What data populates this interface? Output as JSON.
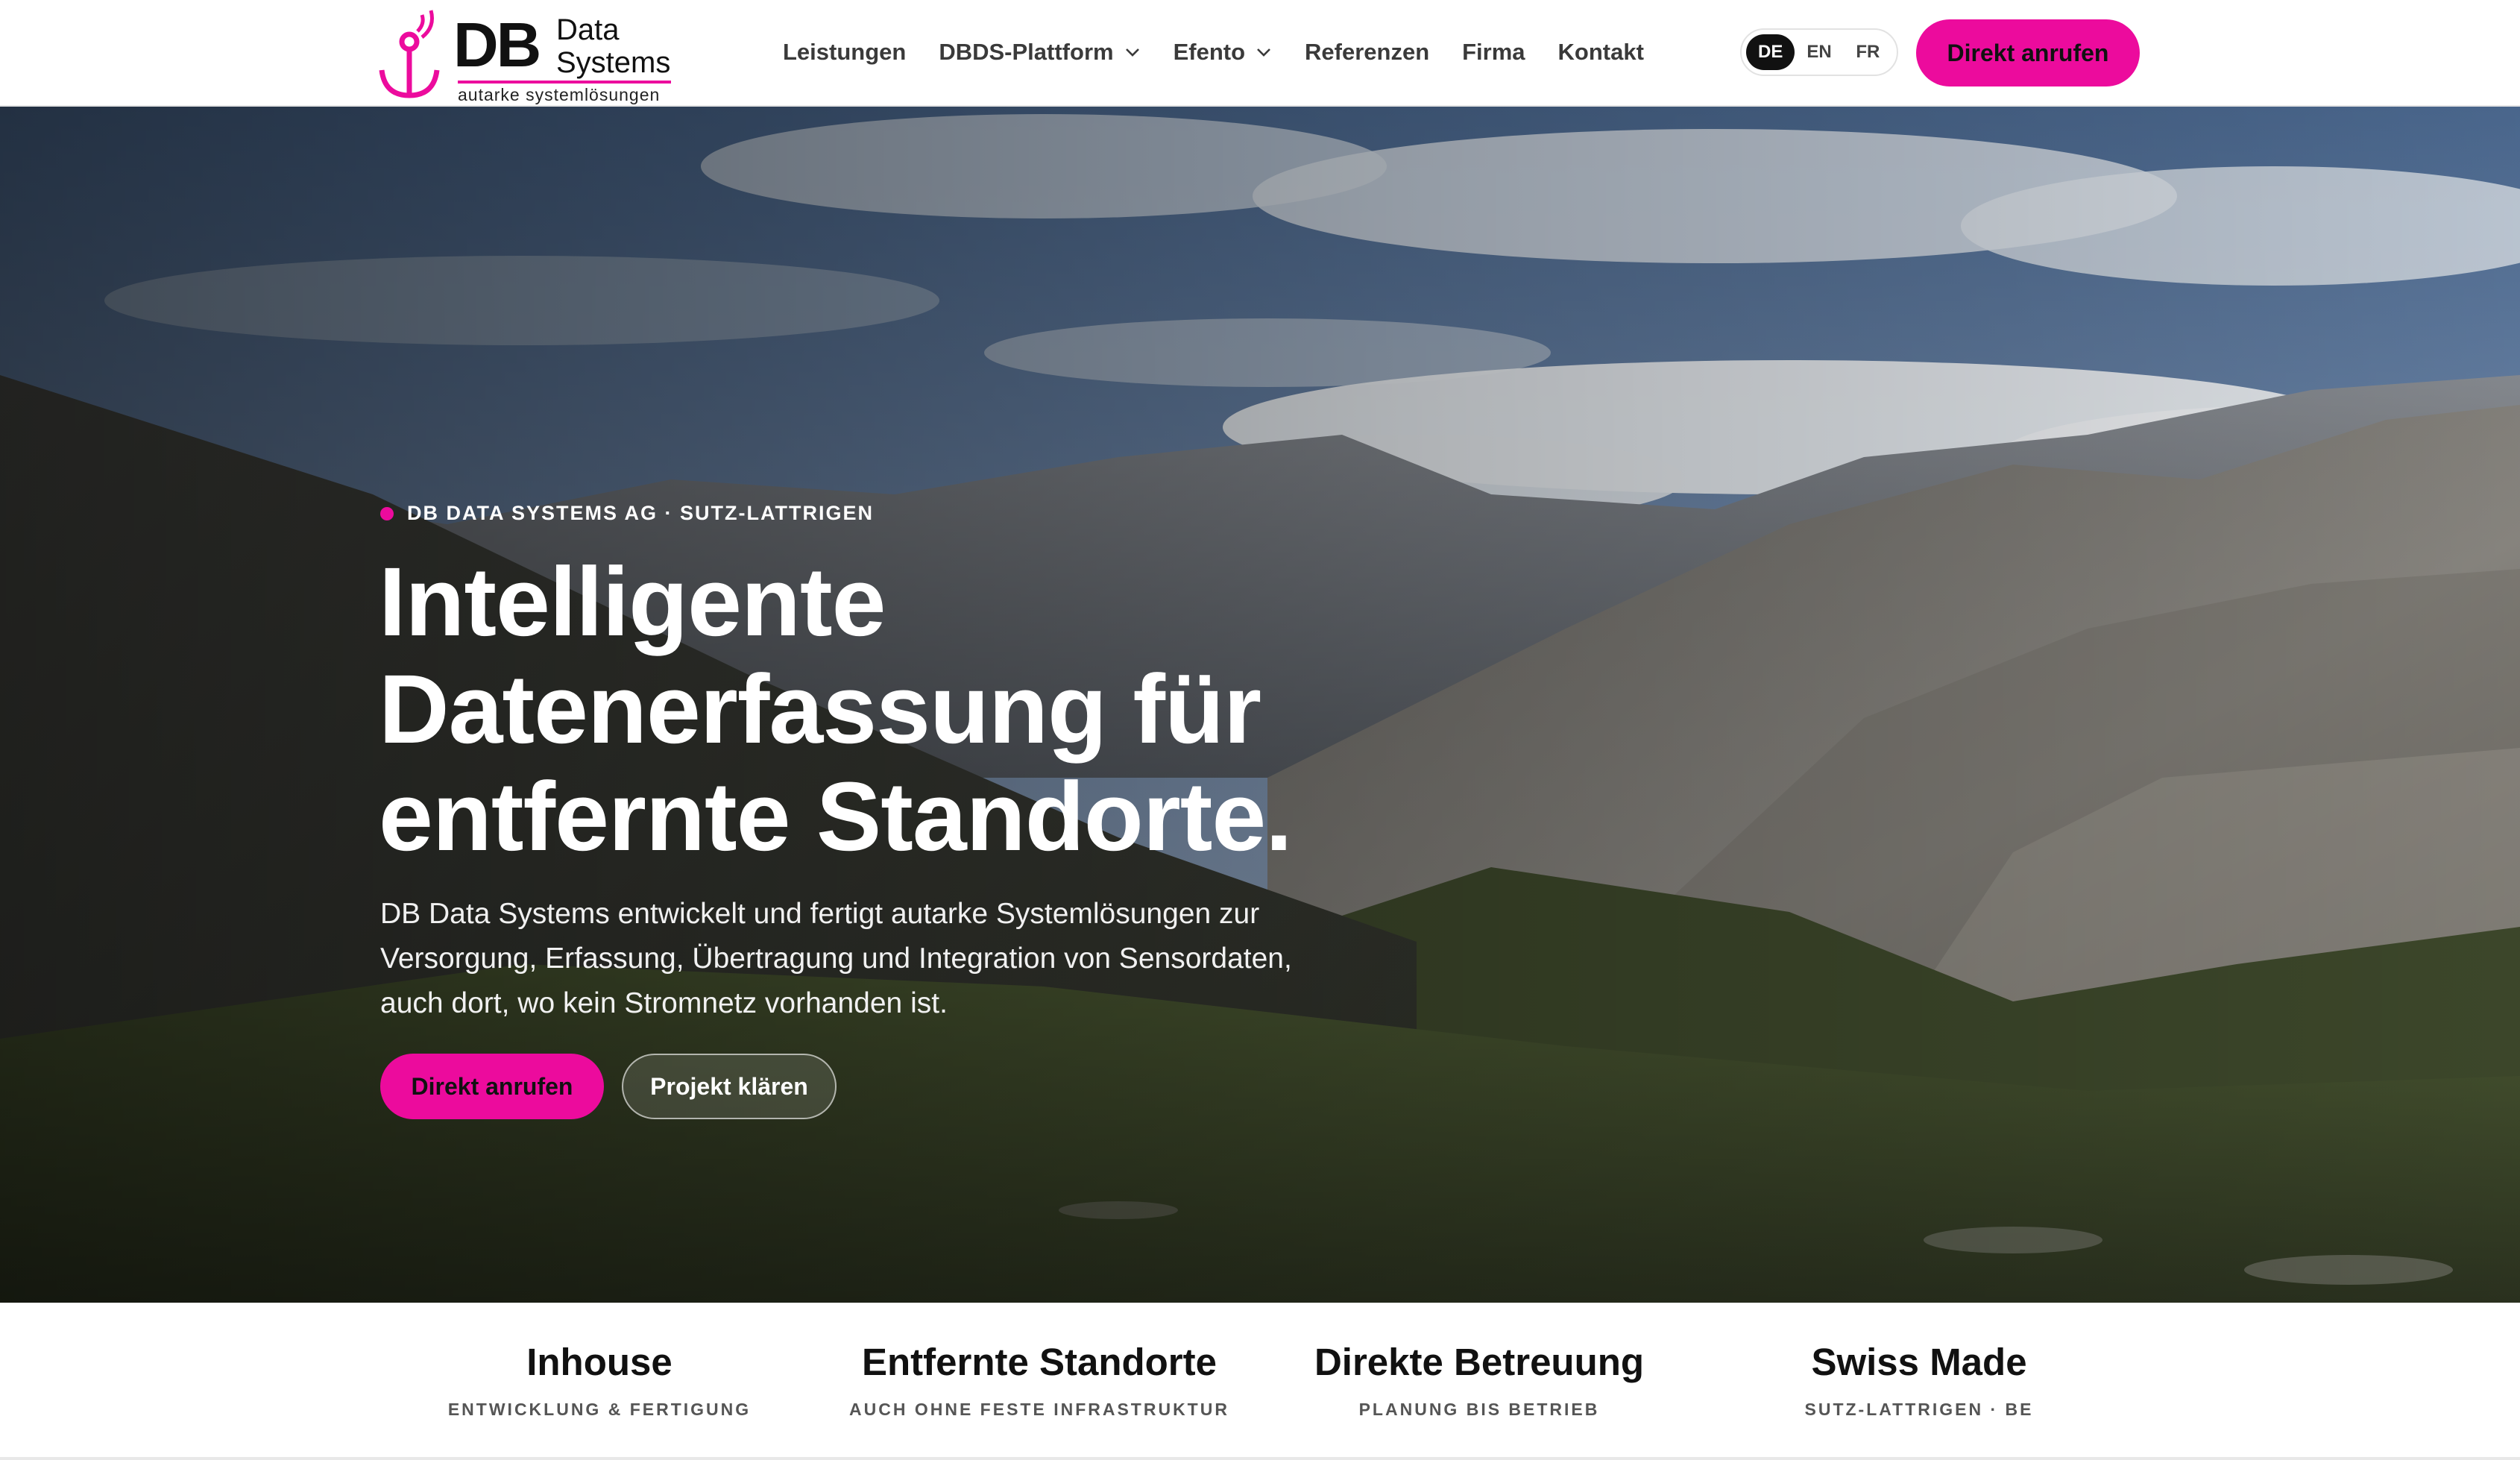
{
  "header": {
    "logo": {
      "db": "DB",
      "data": "Data",
      "systems": "Systems",
      "tagline": "autarke systemlösungen"
    },
    "nav": [
      {
        "label": "Leistungen",
        "has_dropdown": false
      },
      {
        "label": "DBDS-Plattform",
        "has_dropdown": true
      },
      {
        "label": "Efento",
        "has_dropdown": true
      },
      {
        "label": "Referenzen",
        "has_dropdown": false
      },
      {
        "label": "Firma",
        "has_dropdown": false
      },
      {
        "label": "Kontakt",
        "has_dropdown": false
      }
    ],
    "languages": [
      {
        "code": "DE",
        "active": true
      },
      {
        "code": "EN",
        "active": false
      },
      {
        "code": "FR",
        "active": false
      }
    ],
    "cta_label": "Direkt anrufen"
  },
  "hero": {
    "eyebrow": "DB DATA SYSTEMS AG · SUTZ-LATTRIGEN",
    "headline_lines": [
      "Intelligente",
      "Datenerfassung für",
      "entfernte Standorte."
    ],
    "lede": "DB Data Systems entwickelt und fertigt autarke Systemlösungen zur Versorgung, Erfassung, Übertragung und Integration von Sensordaten, auch dort, wo kein Stromnetz vorhanden ist.",
    "primary_cta": "Direkt anrufen",
    "secondary_cta": "Projekt klären"
  },
  "features": [
    {
      "title": "Inhouse",
      "subtitle": "ENTWICKLUNG & FERTIGUNG"
    },
    {
      "title": "Entfernte Standorte",
      "subtitle": "AUCH OHNE FESTE INFRASTRUKTUR"
    },
    {
      "title": "Direkte Betreuung",
      "subtitle": "PLANUNG BIS BETRIEB"
    },
    {
      "title": "Swiss Made",
      "subtitle": "SUTZ-LATTRIGEN · BE"
    }
  ],
  "colors": {
    "accent": "#ec0b9d",
    "text_dark": "#111111",
    "nav_text": "#3a3a3a"
  }
}
